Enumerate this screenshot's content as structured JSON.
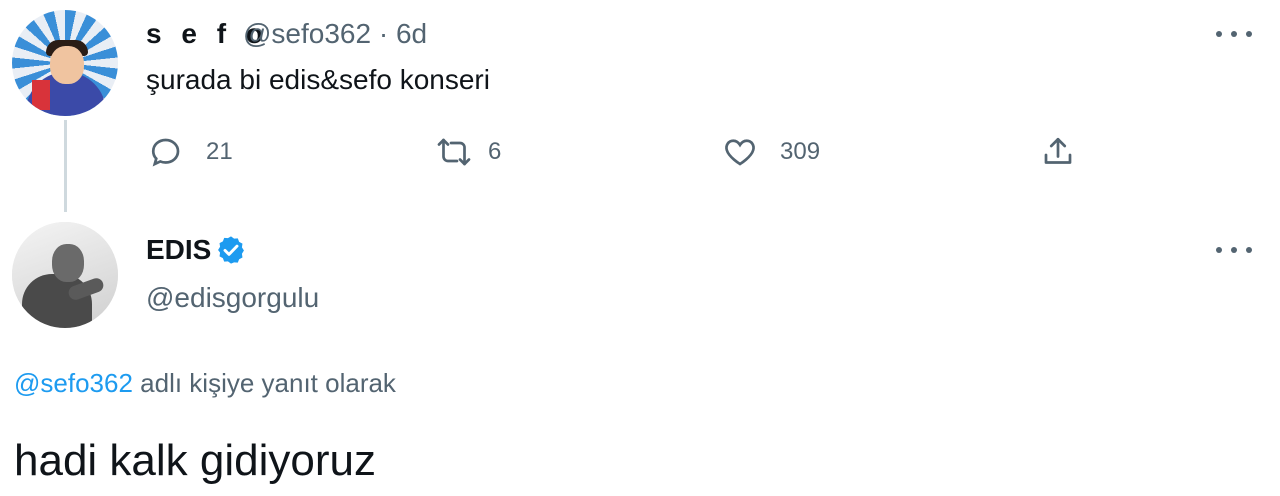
{
  "tweet1": {
    "display_name": "s e f o",
    "handle": "@sefo362",
    "separator": "·",
    "time": "6d",
    "text": "şurada bi edis&sefo konseri",
    "replies": "21",
    "retweets": "6",
    "likes": "309",
    "icons": [
      "reply-icon",
      "retweet-icon",
      "like-icon",
      "share-icon",
      "more-icon"
    ]
  },
  "tweet2": {
    "display_name": "EDIS",
    "verified": true,
    "handle": "@edisgorgulu",
    "reply_mention": "@sefo362",
    "reply_suffix": " adlı kişiye yanıt olarak",
    "text": "hadi kalk gidiyoruz",
    "icons": [
      "verified-badge-icon",
      "more-icon"
    ]
  },
  "colors": {
    "text_primary": "#0f1419",
    "text_secondary": "#536471",
    "accent": "#1d9bf0",
    "thread_line": "#cfd9de"
  }
}
